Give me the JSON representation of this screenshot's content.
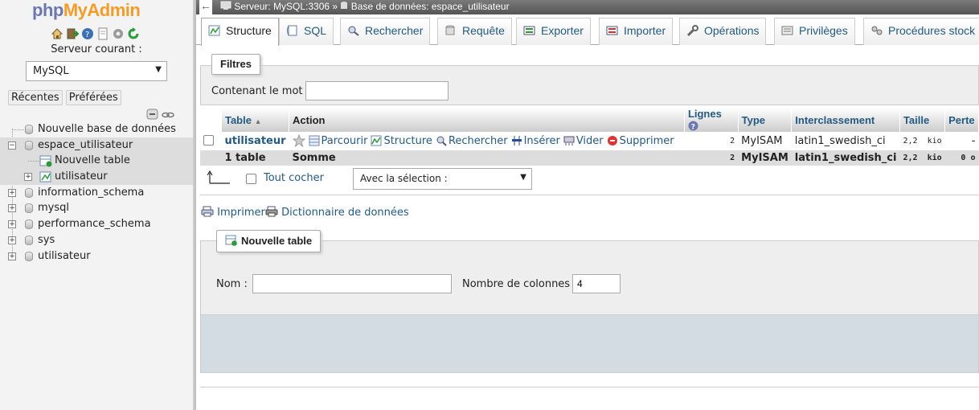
{
  "nav": {
    "logo_part1": "php",
    "logo_part2": "MyAdmin",
    "icons": [
      "home-icon",
      "exit-icon",
      "help-icon",
      "docs-icon",
      "settings-icon",
      "reload-icon"
    ],
    "server_label": "Serveur courant :",
    "server_value": "MySQL",
    "links": [
      "Récentes",
      "Préférées"
    ],
    "tree": [
      {
        "label": "Nouvelle base de données"
      },
      {
        "label": "espace_utilisateur"
      },
      {
        "label": "Nouvelle table"
      },
      {
        "label": "utilisateur"
      },
      {
        "label": "information_schema"
      },
      {
        "label": "mysql"
      },
      {
        "label": "performance_schema"
      },
      {
        "label": "sys"
      },
      {
        "label": "utilisateur"
      }
    ]
  },
  "breadcrumb": {
    "server": "Serveur: MySQL:3306",
    "sep": "»",
    "database": "Base de données: espace_utilisateur"
  },
  "tabs": [
    {
      "label": "Structure",
      "icon": "structure-icon"
    },
    {
      "label": "SQL",
      "icon": "sql-icon"
    },
    {
      "label": "Rechercher",
      "icon": "search-icon"
    },
    {
      "label": "Requête",
      "icon": "query-icon"
    },
    {
      "label": "Exporter",
      "icon": "export-icon"
    },
    {
      "label": "Importer",
      "icon": "import-icon"
    },
    {
      "label": "Opérations",
      "icon": "wrench-icon"
    },
    {
      "label": "Privilèges",
      "icon": "privileges-icon"
    },
    {
      "label": "Procédures stock",
      "icon": "routines-icon"
    }
  ],
  "filters": {
    "legend": "Filtres",
    "label": "Contenant le mot :",
    "value": ""
  },
  "table": {
    "headers": {
      "table": "Table",
      "action": "Action",
      "rows": "Lignes",
      "type": "Type",
      "collation": "Interclassement",
      "size": "Taille",
      "overhead": "Perte"
    },
    "rows": [
      {
        "name": "utilisateur",
        "actions": [
          "Parcourir",
          "Structure",
          "Rechercher",
          "Insérer",
          "Vider",
          "Supprimer"
        ],
        "rows": "2",
        "type": "MyISAM",
        "collation": "latin1_swedish_ci",
        "size_value": "2,2",
        "size_unit": "kio",
        "overhead": "-"
      }
    ],
    "footer": {
      "count": "1 table",
      "sum": "Somme",
      "rows": "2",
      "type": "MyISAM",
      "collation": "latin1_swedish_ci",
      "size_value": "2,2",
      "size_unit": "kio",
      "overhead_value": "0",
      "overhead_unit": "o"
    }
  },
  "bulk": {
    "check_all": "Tout cocher",
    "with_selected": "Avec la sélection :"
  },
  "links": {
    "print": "Imprimer",
    "dictionary": "Dictionnaire de données"
  },
  "new_table": {
    "legend": "Nouvelle table",
    "name_label": "Nom :",
    "name_value": "",
    "columns_label": "Nombre de colonnes :",
    "columns_value": "4"
  }
}
